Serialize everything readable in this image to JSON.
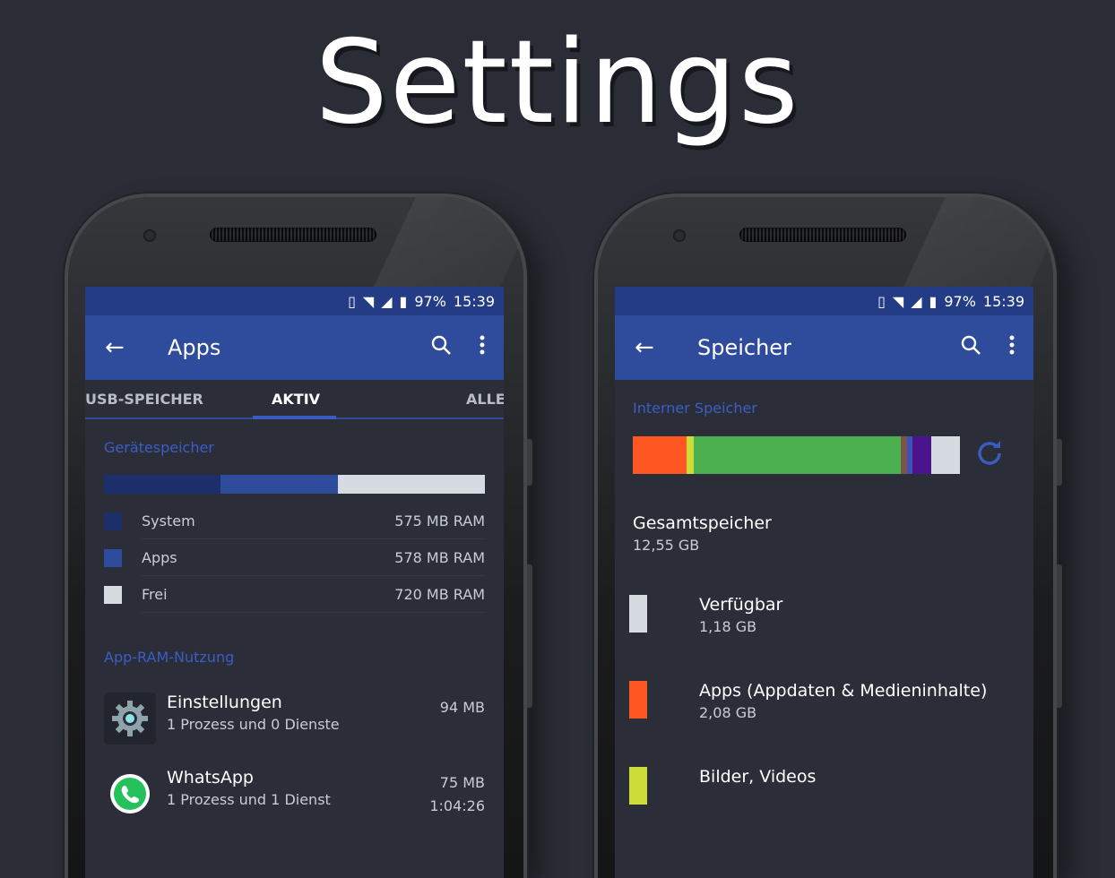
{
  "headline": "Settings",
  "status": {
    "battery": "97%",
    "time": "15:39"
  },
  "left_phone": {
    "title": "Apps",
    "tabs": [
      "USB-SPEICHER",
      "AKTIV",
      "ALLE"
    ],
    "section": "Gerätespeicher",
    "ram_bar": [
      {
        "label": "System",
        "fraction": 0.306,
        "color": "#1c2f6a"
      },
      {
        "label": "Apps",
        "fraction": 0.307,
        "color": "#2f4b9c"
      },
      {
        "label": "Frei",
        "fraction": 0.387,
        "color": "#d6dbe2"
      }
    ],
    "legend": [
      {
        "label": "System",
        "value": "575 MB RAM",
        "color": "#1c2f6a"
      },
      {
        "label": "Apps",
        "value": "578 MB RAM",
        "color": "#2f4b9c"
      },
      {
        "label": "Frei",
        "value": "720 MB RAM",
        "color": "#d6dbe2"
      }
    ],
    "section2": "App-RAM-Nutzung",
    "apps": [
      {
        "name": "Einstellungen",
        "sub": "1 Prozess und 0 Dienste",
        "size": "94 MB",
        "time": ""
      },
      {
        "name": "WhatsApp",
        "sub": "1 Prozess und 1 Dienst",
        "size": "75 MB",
        "time": "1:04:26"
      }
    ]
  },
  "right_phone": {
    "title": "Speicher",
    "section": "Interner Speicher",
    "storage_bar": [
      {
        "fraction": 0.165,
        "color": "#ff5722"
      },
      {
        "fraction": 0.022,
        "color": "#cddc39"
      },
      {
        "fraction": 0.633,
        "color": "#4caf50"
      },
      {
        "fraction": 0.018,
        "color": "#795548"
      },
      {
        "fraction": 0.018,
        "color": "#3f51b5"
      },
      {
        "fraction": 0.056,
        "color": "#4a148c"
      },
      {
        "fraction": 0.088,
        "color": "#d6dbe2"
      }
    ],
    "total_label": "Gesamtspeicher",
    "total_value": "12,55 GB",
    "items": [
      {
        "name": "Verfügbar",
        "value": "1,18 GB",
        "color": "#d6dbe2"
      },
      {
        "name": "Apps (Appdaten & Medieninhalte)",
        "value": "2,08 GB",
        "color": "#ff5722"
      },
      {
        "name": "Bilder, Videos",
        "value": "",
        "color": "#cddc39"
      }
    ]
  }
}
